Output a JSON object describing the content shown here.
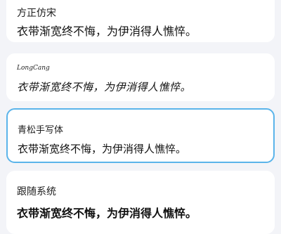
{
  "font_options": [
    {
      "name": "方正仿宋",
      "sample": "衣带渐宽终不悔，为伊消得人憔悴。",
      "selected": false
    },
    {
      "name": "LongCang",
      "sample": "衣带渐宽终不悔，为伊消得人憔悴。",
      "selected": false
    },
    {
      "name": "青松手写体",
      "sample": "衣带渐宽终不悔，为伊消得人憔悴。",
      "selected": true
    },
    {
      "name": "跟随系统",
      "sample": "衣带渐宽终不悔，为伊消得人憔悴。",
      "selected": false
    }
  ],
  "colors": {
    "page_background": "#f3f4f8",
    "card_background": "#ffffff",
    "selected_border": "#5ab4ea"
  }
}
